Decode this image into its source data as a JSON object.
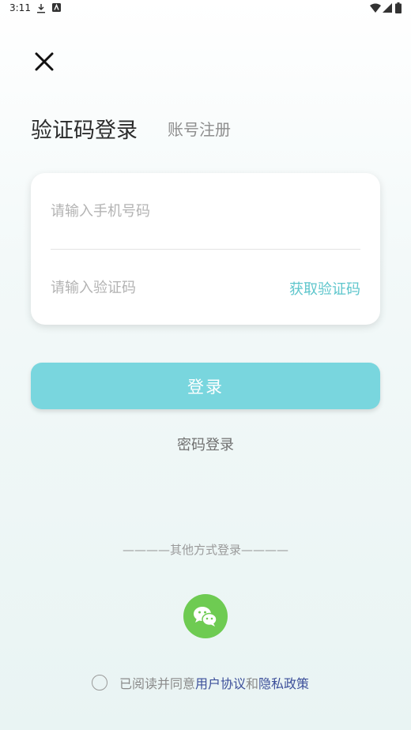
{
  "status_bar": {
    "time": "3:11"
  },
  "tabs": {
    "active": "验证码登录",
    "inactive": "账号注册"
  },
  "form": {
    "phone_placeholder": "请输入手机号码",
    "code_placeholder": "请输入验证码",
    "get_code_label": "获取验证码"
  },
  "login_button": "登录",
  "password_login": "密码登录",
  "other_methods_label": "————其他方式登录————",
  "agreement": {
    "prefix": "已阅读并同意",
    "user_agreement": "用户协议",
    "and": "和",
    "privacy_policy": "隐私政策"
  },
  "icons": {
    "close": "close-icon",
    "wechat": "wechat-icon",
    "download": "download-icon",
    "wifi": "wifi-icon",
    "signal": "signal-icon",
    "battery": "battery-icon"
  },
  "colors": {
    "accent": "#79d6de",
    "link_accent": "#5ec6cc",
    "wechat": "#6ecb52",
    "policy_link": "#3c4f9a"
  }
}
